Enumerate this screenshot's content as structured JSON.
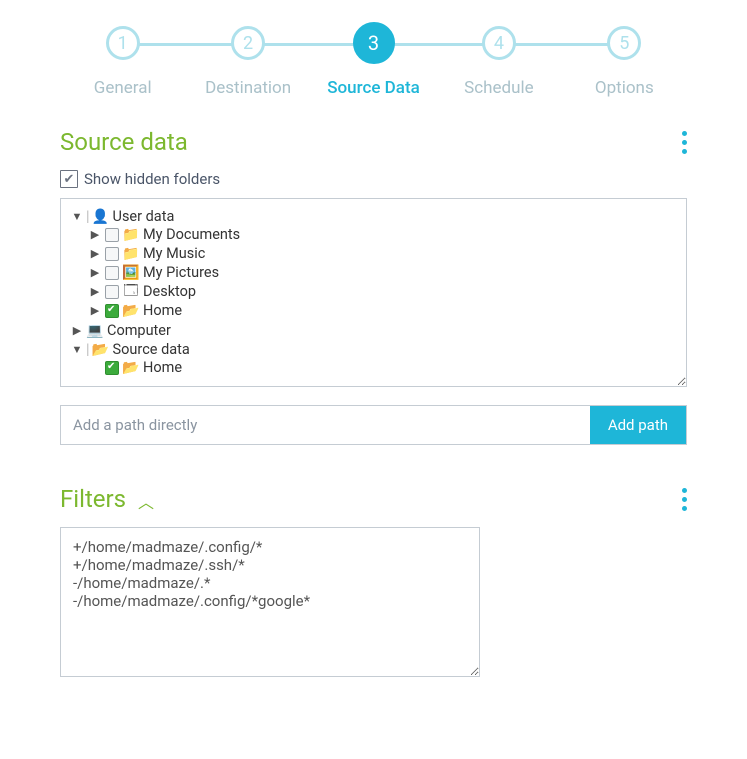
{
  "stepper": {
    "items": [
      {
        "num": "1",
        "label": "General"
      },
      {
        "num": "2",
        "label": "Destination"
      },
      {
        "num": "3",
        "label": "Source Data"
      },
      {
        "num": "4",
        "label": "Schedule"
      },
      {
        "num": "5",
        "label": "Options"
      }
    ],
    "active_index": 2
  },
  "source": {
    "title": "Source data",
    "show_hidden_label": "Show hidden folders",
    "show_hidden_checked": true,
    "path_placeholder": "Add a path directly",
    "path_button": "Add path"
  },
  "tree": {
    "user_data": {
      "label": "User data",
      "expanded": true
    },
    "my_documents": {
      "label": "My Documents",
      "expanded": false,
      "checked": false
    },
    "my_music": {
      "label": "My Music",
      "expanded": false,
      "checked": false
    },
    "my_pictures": {
      "label": "My Pictures",
      "expanded": false,
      "checked": false
    },
    "desktop": {
      "label": "Desktop",
      "expanded": false,
      "checked": false
    },
    "home": {
      "label": "Home",
      "expanded": false,
      "checked": true
    },
    "computer": {
      "label": "Computer",
      "expanded": false
    },
    "source_data": {
      "label": "Source data",
      "expanded": true
    },
    "source_home": {
      "label": "Home",
      "checked": true
    }
  },
  "filters": {
    "title": "Filters",
    "text": "+/home/madmaze/.config/*\n+/home/madmaze/.ssh/*\n-/home/madmaze/.*\n-/home/madmaze/.config/*google*"
  }
}
